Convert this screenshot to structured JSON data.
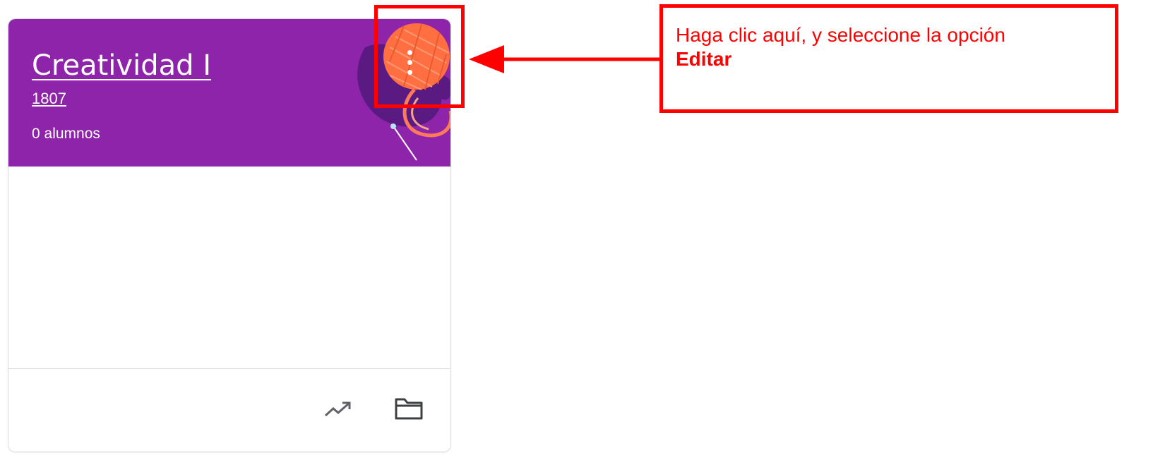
{
  "class_card": {
    "title": "Creatividad I",
    "section": "1807",
    "students": "0 alumnos",
    "header_color": "#8e24aa",
    "more_icon": "more-vert-icon",
    "footer_icons": [
      "trending-up-icon",
      "folder-icon"
    ]
  },
  "annotation": {
    "text": "Haga clic aquí, y seleccione la opción",
    "bold_text": "Editar",
    "color": "#ff0000"
  }
}
